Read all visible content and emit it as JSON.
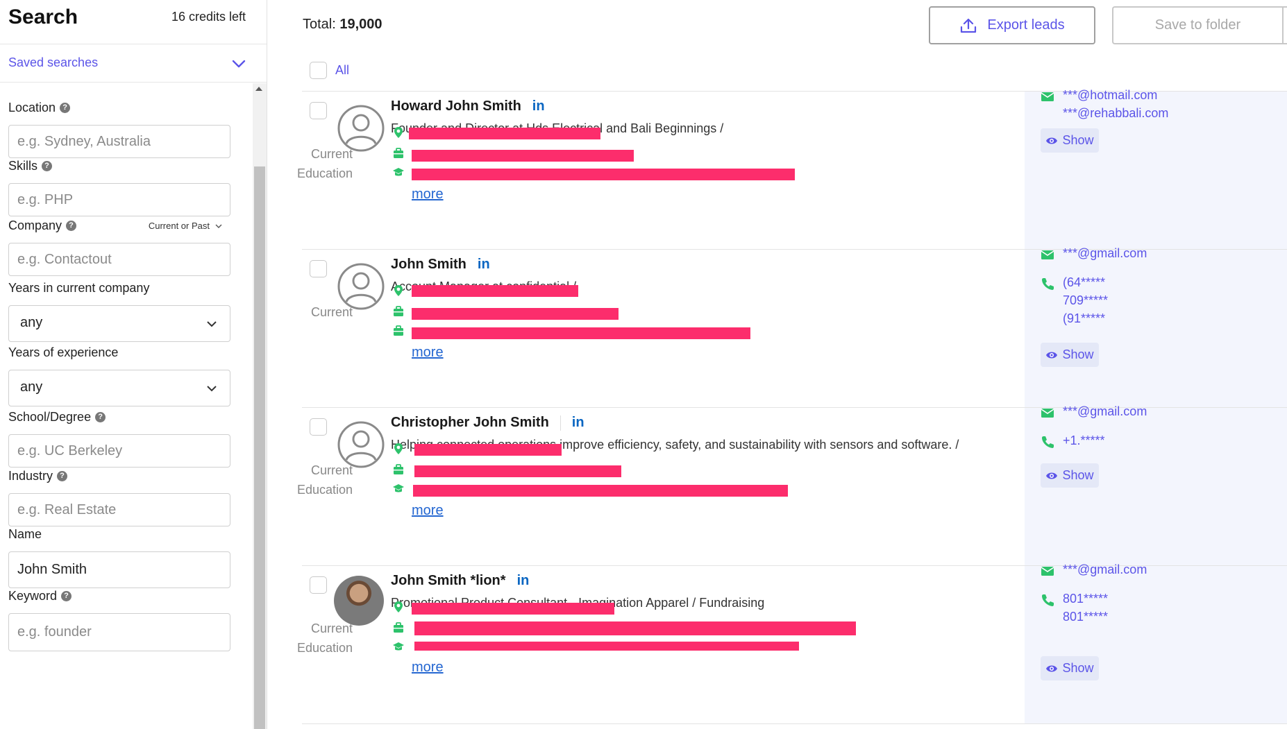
{
  "sidebar": {
    "title": "Search",
    "credits": "16 credits left",
    "saved_searches": "Saved searches",
    "fields": {
      "location": {
        "label": "Location",
        "placeholder": "e.g. Sydney, Australia"
      },
      "skills": {
        "label": "Skills",
        "placeholder": "e.g. PHP"
      },
      "company": {
        "label": "Company",
        "placeholder": "e.g. Contactout",
        "extra": "Current or Past"
      },
      "years_company": {
        "label": "Years in current company",
        "value": "any"
      },
      "years_experience": {
        "label": "Years of experience",
        "value": "any"
      },
      "school": {
        "label": "School/Degree",
        "placeholder": "e.g. UC Berkeley"
      },
      "industry": {
        "label": "Industry",
        "placeholder": "e.g. Real Estate"
      },
      "name": {
        "label": "Name",
        "value": "John Smith"
      },
      "keyword": {
        "label": "Keyword",
        "placeholder": "e.g. founder"
      }
    }
  },
  "main": {
    "total_label": "Total:",
    "total_value": "19,000",
    "export_label": "Export leads",
    "save_label": "Save to folder",
    "all_label": "All",
    "more_label": "more",
    "show_label": "Show",
    "labels": {
      "current": "Current",
      "education": "Education"
    },
    "results": [
      {
        "name": "Howard John Smith",
        "headline": "Founder and Director at Hds Electrical and Bali Beginnings /",
        "emails": [
          "***@hotmail.com",
          "***@rehabbali.com"
        ],
        "phones": []
      },
      {
        "name": "John Smith",
        "headline": "Account Manager at confidential /",
        "emails": [
          "***@gmail.com"
        ],
        "phones": [
          "(64*****",
          "709*****",
          "(91*****"
        ]
      },
      {
        "name": "Christopher John Smith",
        "headline": "Helping connected operations improve efficiency, safety, and sustainability with sensors and software. /",
        "emails": [
          "***@gmail.com"
        ],
        "phones": [
          "+1.*****"
        ]
      },
      {
        "name": "John Smith *lion*",
        "headline": "Promotional Product Consultant - Imagination Apparel / Fundraising",
        "emails": [
          "***@gmail.com"
        ],
        "phones": [
          "801*****",
          "801*****"
        ]
      }
    ]
  },
  "colors": {
    "accent": "#5b54e8",
    "green_icon": "#2dc26b",
    "redaction": "#fc2d6c",
    "linkedin": "#0a66c2",
    "contact_bg": "#f3f5fd"
  },
  "icons": {
    "help": "help-icon",
    "chevron": "chevron-down-icon",
    "upload": "upload-icon",
    "avatar": "user-avatar-icon",
    "linkedin": "linkedin-icon",
    "location": "map-pin-icon",
    "briefcase": "briefcase-icon",
    "education": "graduation-cap-icon",
    "email": "envelope-icon",
    "phone": "phone-icon",
    "show": "eye-icon"
  }
}
